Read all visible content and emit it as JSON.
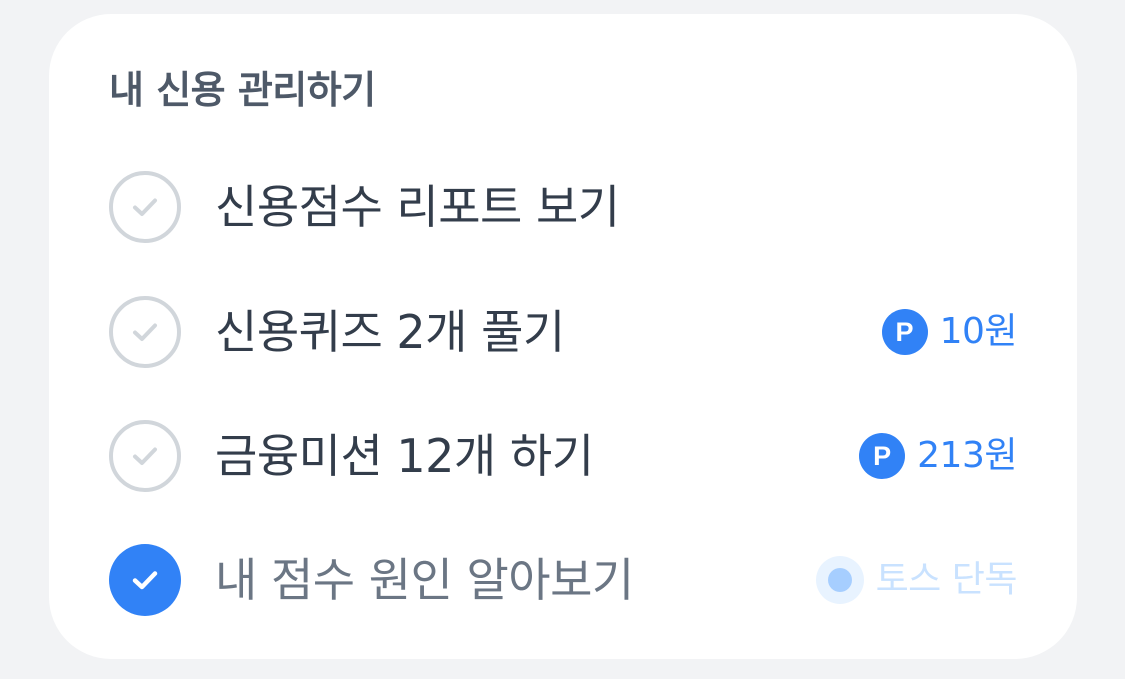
{
  "card": {
    "title": "내 신용 관리하기",
    "items": [
      {
        "label": "신용점수 리포트 보기",
        "completed": false
      },
      {
        "label": "신용퀴즈 2개 풀기",
        "completed": false,
        "reward_icon": "point-icon",
        "reward_icon_text": "P",
        "reward": "10원"
      },
      {
        "label": "금융미션 12개 하기",
        "completed": false,
        "reward_icon": "point-icon",
        "reward_icon_text": "P",
        "reward": "213원"
      },
      {
        "label": "내 점수 원인 알아보기",
        "completed": true,
        "tag_icon": "dot-icon",
        "tag": "토스 단독"
      }
    ]
  },
  "colors": {
    "page_background": "#f2f3f5",
    "card_background": "#ffffff",
    "accent": "#3182f6",
    "check_outline": "#d1d6db",
    "tag_text": "#c9e2ff"
  }
}
